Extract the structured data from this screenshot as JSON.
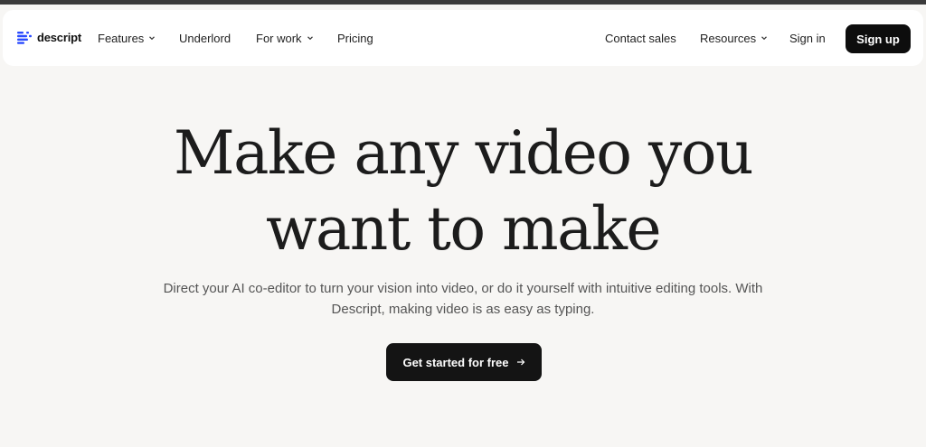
{
  "brand": {
    "name": "descript",
    "logo_icon": "descript-logo-icon",
    "accent_color": "#2a4bff"
  },
  "nav": {
    "left": [
      {
        "label": "Features",
        "has_dropdown": true
      },
      {
        "label": "Underlord",
        "has_dropdown": false
      },
      {
        "label": "For work",
        "has_dropdown": true
      },
      {
        "label": "Pricing",
        "has_dropdown": false
      }
    ],
    "right": [
      {
        "label": "Contact sales",
        "has_dropdown": false
      },
      {
        "label": "Resources",
        "has_dropdown": true
      },
      {
        "label": "Sign in",
        "has_dropdown": false
      }
    ],
    "signup_label": "Sign up"
  },
  "hero": {
    "title_line1": "Make any video you",
    "title_line2": "want to make",
    "subtitle": "Direct your AI co-editor to turn your vision into video, or do it yourself with intuitive editing tools. With Descript,  making video is as easy as typing.",
    "cta_label": "Get started for free",
    "cta_icon": "arrow-right-icon"
  }
}
